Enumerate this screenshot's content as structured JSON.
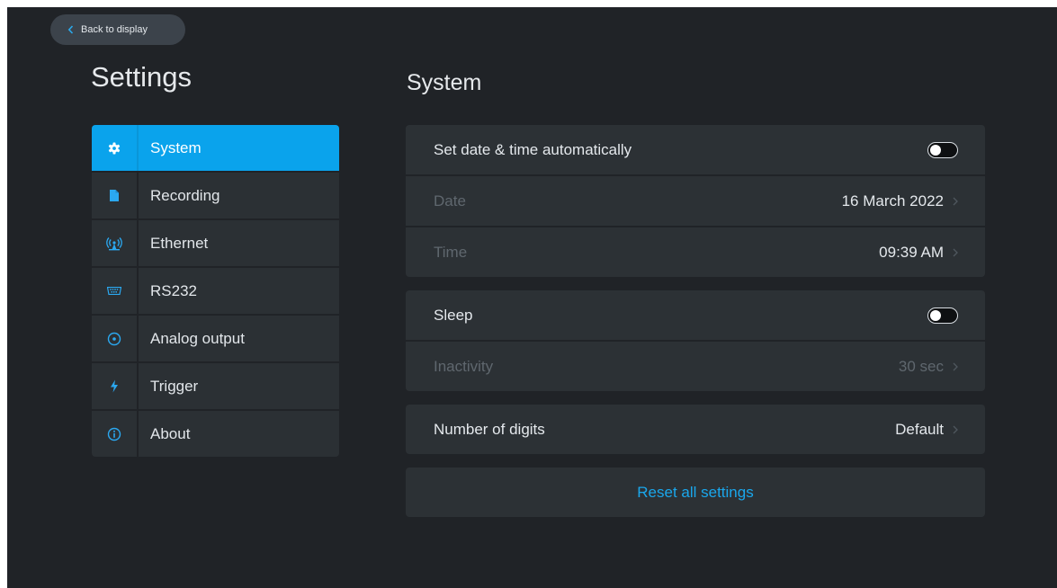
{
  "back_button": {
    "label": "Back to display",
    "icon": "chevron-left-icon"
  },
  "settings_title": "Settings",
  "page_title": "System",
  "sidebar": {
    "items": [
      {
        "label": "System",
        "icon": "gear-icon",
        "active": true
      },
      {
        "label": "Recording",
        "icon": "file-icon",
        "active": false
      },
      {
        "label": "Ethernet",
        "icon": "network-antenna-icon",
        "active": false
      },
      {
        "label": "RS232",
        "icon": "serial-port-icon",
        "active": false
      },
      {
        "label": "Analog output",
        "icon": "target-circle-icon",
        "active": false
      },
      {
        "label": "Trigger",
        "icon": "lightning-bolt-icon",
        "active": false
      },
      {
        "label": "About",
        "icon": "info-icon",
        "active": false
      }
    ]
  },
  "system": {
    "auto_datetime": {
      "label": "Set date & time automatically",
      "enabled": false
    },
    "date": {
      "label": "Date",
      "value": "16 March 2022"
    },
    "time": {
      "label": "Time",
      "value": "09:39 AM"
    },
    "sleep": {
      "label": "Sleep",
      "enabled": false
    },
    "inactivity": {
      "label": "Inactivity",
      "value": "30 sec"
    },
    "digits": {
      "label": "Number of digits",
      "value": "Default"
    },
    "reset_label": "Reset all settings"
  },
  "colors": {
    "accent": "#0aa3ec",
    "background": "#202327",
    "panel": "#2c3135",
    "link": "#1aa7ec"
  }
}
